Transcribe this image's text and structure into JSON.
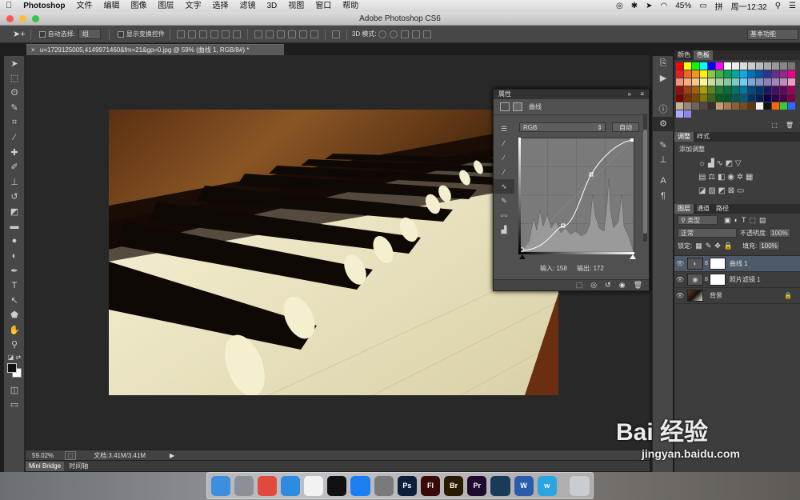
{
  "menubar": {
    "app_name": "Photoshop",
    "items": [
      "文件",
      "编辑",
      "图像",
      "图层",
      "文字",
      "选择",
      "滤镜",
      "3D",
      "视图",
      "窗口",
      "帮助"
    ],
    "battery": "45%",
    "clock": "周一12:32"
  },
  "window": {
    "title": "Adobe Photoshop CS6"
  },
  "options": {
    "auto_select_label": "自动选择:",
    "auto_select_value": "组",
    "show_transform_label": "显示变换控件",
    "mode_3d_label": "3D 模式:",
    "workspace": "基本功能"
  },
  "document": {
    "tab_label": "u=1729125005,4149971460&fm=21&gp=0.jpg @ 59% (曲线 1, RGB/8#) *",
    "zoom": "59.02%",
    "doc_size": "文档:3.41M/3.41M"
  },
  "bottom_tabs": [
    "Mini Bridge",
    "时间轴"
  ],
  "properties": {
    "panel_title": "属性",
    "adjustment_name": "曲线",
    "channel": "RGB",
    "auto_button": "自动",
    "input_label": "输入: 158",
    "output_label": "输出: 172"
  },
  "swatches_panel": {
    "tabs": [
      "颜色",
      "色板"
    ]
  },
  "adjustments_panel": {
    "tabs": [
      "调整",
      "样式"
    ],
    "add_label": "添加调整"
  },
  "layers_panel": {
    "tabs": [
      "图层",
      "通道",
      "路径"
    ],
    "filter_kind": "类型",
    "blend_mode": "正常",
    "opacity_label": "不透明度:",
    "opacity_value": "100%",
    "lock_label": "锁定:",
    "fill_label": "填充:",
    "fill_value": "100%",
    "layers": [
      {
        "name": "曲线 1",
        "selected": true
      },
      {
        "name": "照片滤镜 1",
        "selected": false
      },
      {
        "name": "背景",
        "selected": false
      }
    ]
  },
  "dock": {
    "apps": [
      {
        "name": "finder-icon",
        "label": "",
        "color": "#3e8ede"
      },
      {
        "name": "launchpad-icon",
        "label": "",
        "color": "#8a8f98"
      },
      {
        "name": "chrome-icon",
        "label": "",
        "color": "#e04a3c"
      },
      {
        "name": "safari-icon",
        "label": "",
        "color": "#2f8be0"
      },
      {
        "name": "photos-icon",
        "label": "",
        "color": "#f2f2f2"
      },
      {
        "name": "qq-icon",
        "label": "",
        "color": "#111111"
      },
      {
        "name": "app-store-icon",
        "label": "",
        "color": "#1d7ef2"
      },
      {
        "name": "system-preferences-icon",
        "label": "",
        "color": "#7a7a7a"
      },
      {
        "name": "photoshop-icon",
        "label": "Ps",
        "color": "#0b1f3a"
      },
      {
        "name": "flash-icon",
        "label": "Fl",
        "color": "#3a0a0a"
      },
      {
        "name": "bridge-icon",
        "label": "Br",
        "color": "#2a1a00"
      },
      {
        "name": "premiere-icon",
        "label": "Pr",
        "color": "#1e0a2e"
      },
      {
        "name": "quicktime-icon",
        "label": "",
        "color": "#1a3a5a"
      },
      {
        "name": "word-icon",
        "label": "W",
        "color": "#2a5cab"
      },
      {
        "name": "wunderlist-icon",
        "label": "w",
        "color": "#2aa5e0"
      },
      {
        "name": "trash-icon",
        "label": "",
        "color": "#c9ccd0"
      }
    ]
  },
  "watermark": {
    "brand": "Bai 经验",
    "url": "jingyan.baidu.com"
  }
}
